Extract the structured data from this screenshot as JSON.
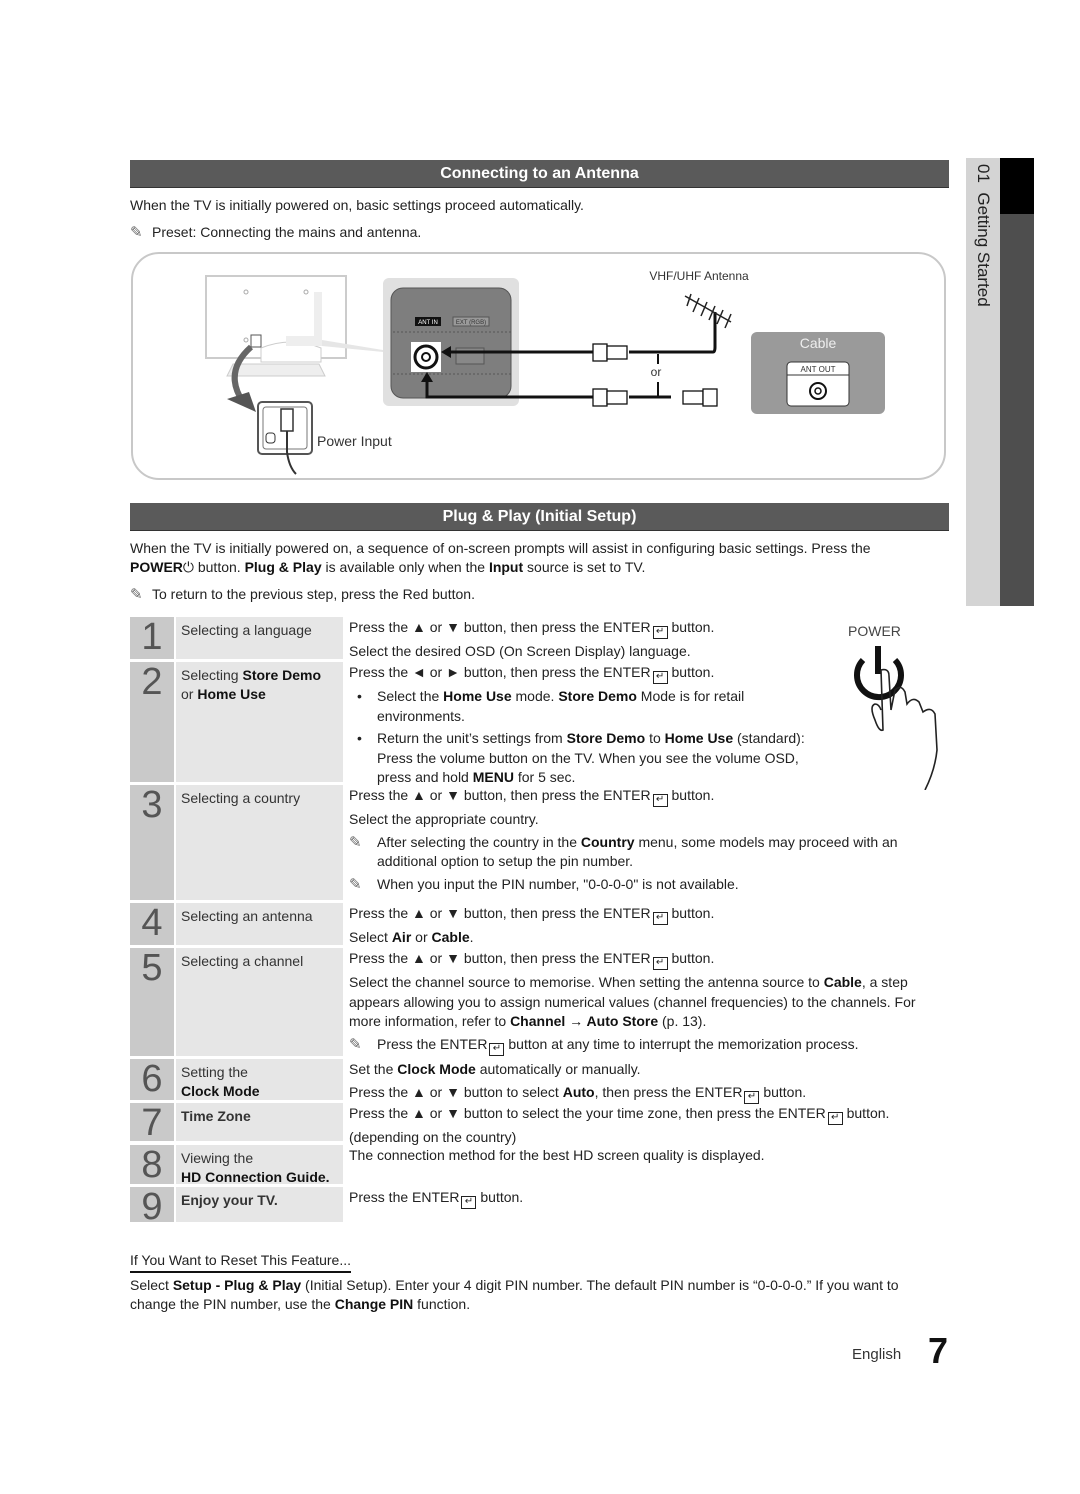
{
  "antenna_section": {
    "title": "Connecting to an Antenna",
    "intro": "When the TV is initially powered on, basic settings proceed automatically.",
    "note": "Preset: Connecting the mains and antenna.",
    "diagram": {
      "antenna_label": "VHF/UHF Antenna",
      "or_label": "or",
      "cable_box_label": "Cable",
      "ant_out_label": "ANT OUT",
      "ant_in_label": "ANT IN",
      "ext_label": "EXT (RGB)",
      "power_input_label": "Power Input"
    }
  },
  "side_tab": {
    "chapter": "01",
    "label": "Getting Started"
  },
  "plug_play_section": {
    "title": "Plug & Play (Initial Setup)",
    "intro_1": "When the TV is initially powered on, a sequence of on-screen prompts will assist in configuring basic settings. Press the",
    "intro_power": "POWER",
    "intro_2": "button.",
    "intro_plug": "Plug & Play",
    "intro_3": "is available only when the",
    "intro_input": "Input",
    "intro_4": "source is set to TV.",
    "note": "To return to the previous step, press the Red button.",
    "power_label": "POWER"
  },
  "steps": [
    {
      "num": "1",
      "title": "Selecting a language",
      "line1": "Press the ▲ or ▼ button, then press the ENTER",
      "line1_end": "button.",
      "line2": "Select the desired OSD (On Screen Display) language."
    },
    {
      "num": "2",
      "title_a": "Selecting ",
      "title_b": "Store Demo",
      "title_c": "or ",
      "title_d": "Home Use",
      "line1": "Press the ◄ or ► button, then press the ENTER",
      "line1_end": "button.",
      "bullet1_a": "Select the ",
      "bullet1_b": "Home Use",
      "bullet1_c": " mode. ",
      "bullet1_d": "Store Demo",
      "bullet1_e": " Mode is for retail environments.",
      "bullet2_a": "Return the unit’s settings from ",
      "bullet2_b": "Store Demo",
      "bullet2_c": " to ",
      "bullet2_d": "Home Use",
      "bullet2_e": " (standard): Press the volume button on the TV. When you see the volume OSD, press and hold ",
      "bullet2_f": "MENU",
      "bullet2_g": " for 5 sec."
    },
    {
      "num": "3",
      "title": "Selecting a country",
      "line1": "Press the ▲ or ▼ button, then press the ENTER",
      "line1_end": "button.",
      "line2": "Select the appropriate country.",
      "note1_a": "After selecting the country in the ",
      "note1_b": "Country",
      "note1_c": " menu, some models may proceed with an additional option to setup the pin number.",
      "note2": "When you input the PIN number, \"0-0-0-0\" is not available."
    },
    {
      "num": "4",
      "title": "Selecting an antenna",
      "line1": "Press the ▲ or ▼ button, then press the ENTER",
      "line1_end": "button.",
      "line2_a": "Select ",
      "line2_b": "Air",
      "line2_c": " or ",
      "line2_d": "Cable",
      "line2_e": "."
    },
    {
      "num": "5",
      "title": "Selecting a channel",
      "line1": "Press the ▲ or ▼ button, then press the ENTER",
      "line1_end": "button.",
      "line2_a": "Select the channel source to memorise. When setting the antenna source to ",
      "line2_b": "Cable",
      "line2_c": ", a step appears allowing you to assign numerical values (channel frequencies) to the channels. For more information, refer to ",
      "line2_d": "Channel → Auto Store",
      "line2_e": " (p. 13).",
      "note_a": "Press the ENTER",
      "note_b": "button at any time to interrupt the memorization process."
    },
    {
      "num": "6",
      "title_a": "Setting the",
      "title_b": "Clock Mode",
      "line1_a": "Set the ",
      "line1_b": "Clock Mode",
      "line1_c": " automatically or manually.",
      "line2_a": "Press the ▲ or ▼ button to select ",
      "line2_b": "Auto",
      "line2_c": ", then press the ENTER",
      "line2_end": "button."
    },
    {
      "num": "7",
      "title": "Time Zone",
      "line1": "Press the ▲ or ▼ button to select the your time zone, then press the ENTER",
      "line1_end": "button.",
      "line2": "(depending on the country)"
    },
    {
      "num": "8",
      "title_a": "Viewing the",
      "title_b": "HD Connection Guide.",
      "line1": "The connection method for the best HD screen quality is displayed."
    },
    {
      "num": "9",
      "title": "Enjoy your TV.",
      "line1": "Press the ENTER",
      "line1_end": "button."
    }
  ],
  "reset_section": {
    "heading": "If You Want to Reset This Feature...",
    "text_a": "Select ",
    "text_b": "Setup - Plug & Play",
    "text_c": " (Initial Setup). Enter your 4 digit PIN number. The default PIN number is “0-0-0-0.” If you want to change the PIN number, use the ",
    "text_d": "Change PIN",
    "text_e": " function."
  },
  "footer": {
    "language": "English",
    "page_number": "7"
  },
  "colors": {
    "section_bar": "#5a5a5a",
    "number_cell": "#c9c9c9",
    "title_cell": "#e6e6e6",
    "side_dark": "#4e4e4e",
    "cable_box": "#9a9a9a"
  }
}
